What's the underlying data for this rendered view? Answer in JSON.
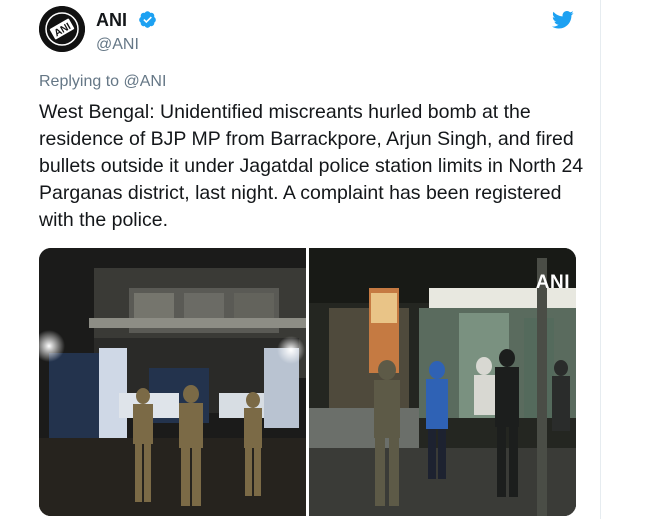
{
  "account": {
    "display_name": "ANI",
    "handle": "@ANI",
    "avatar_text": "ANI",
    "verified": true
  },
  "reply_context": {
    "prefix": "Replying to ",
    "mention": "@ANI"
  },
  "tweet": {
    "text": "West Bengal: Unidentified miscreants hurled bomb at the residence of BJP MP from Barrackpore, Arjun Singh, and fired bullets outside it under Jagatdal police station limits in North 24 Parganas district, last night. A complaint has been registered with the police."
  },
  "media": {
    "watermark": "ANI",
    "photo_count": 2
  },
  "colors": {
    "twitter_blue": "#1da1f2",
    "text_primary": "#14171a",
    "text_secondary": "#657786",
    "border": "#e6ecf0"
  },
  "icons": {
    "brand": "twitter-bird-icon",
    "verified": "verified-badge-icon"
  }
}
